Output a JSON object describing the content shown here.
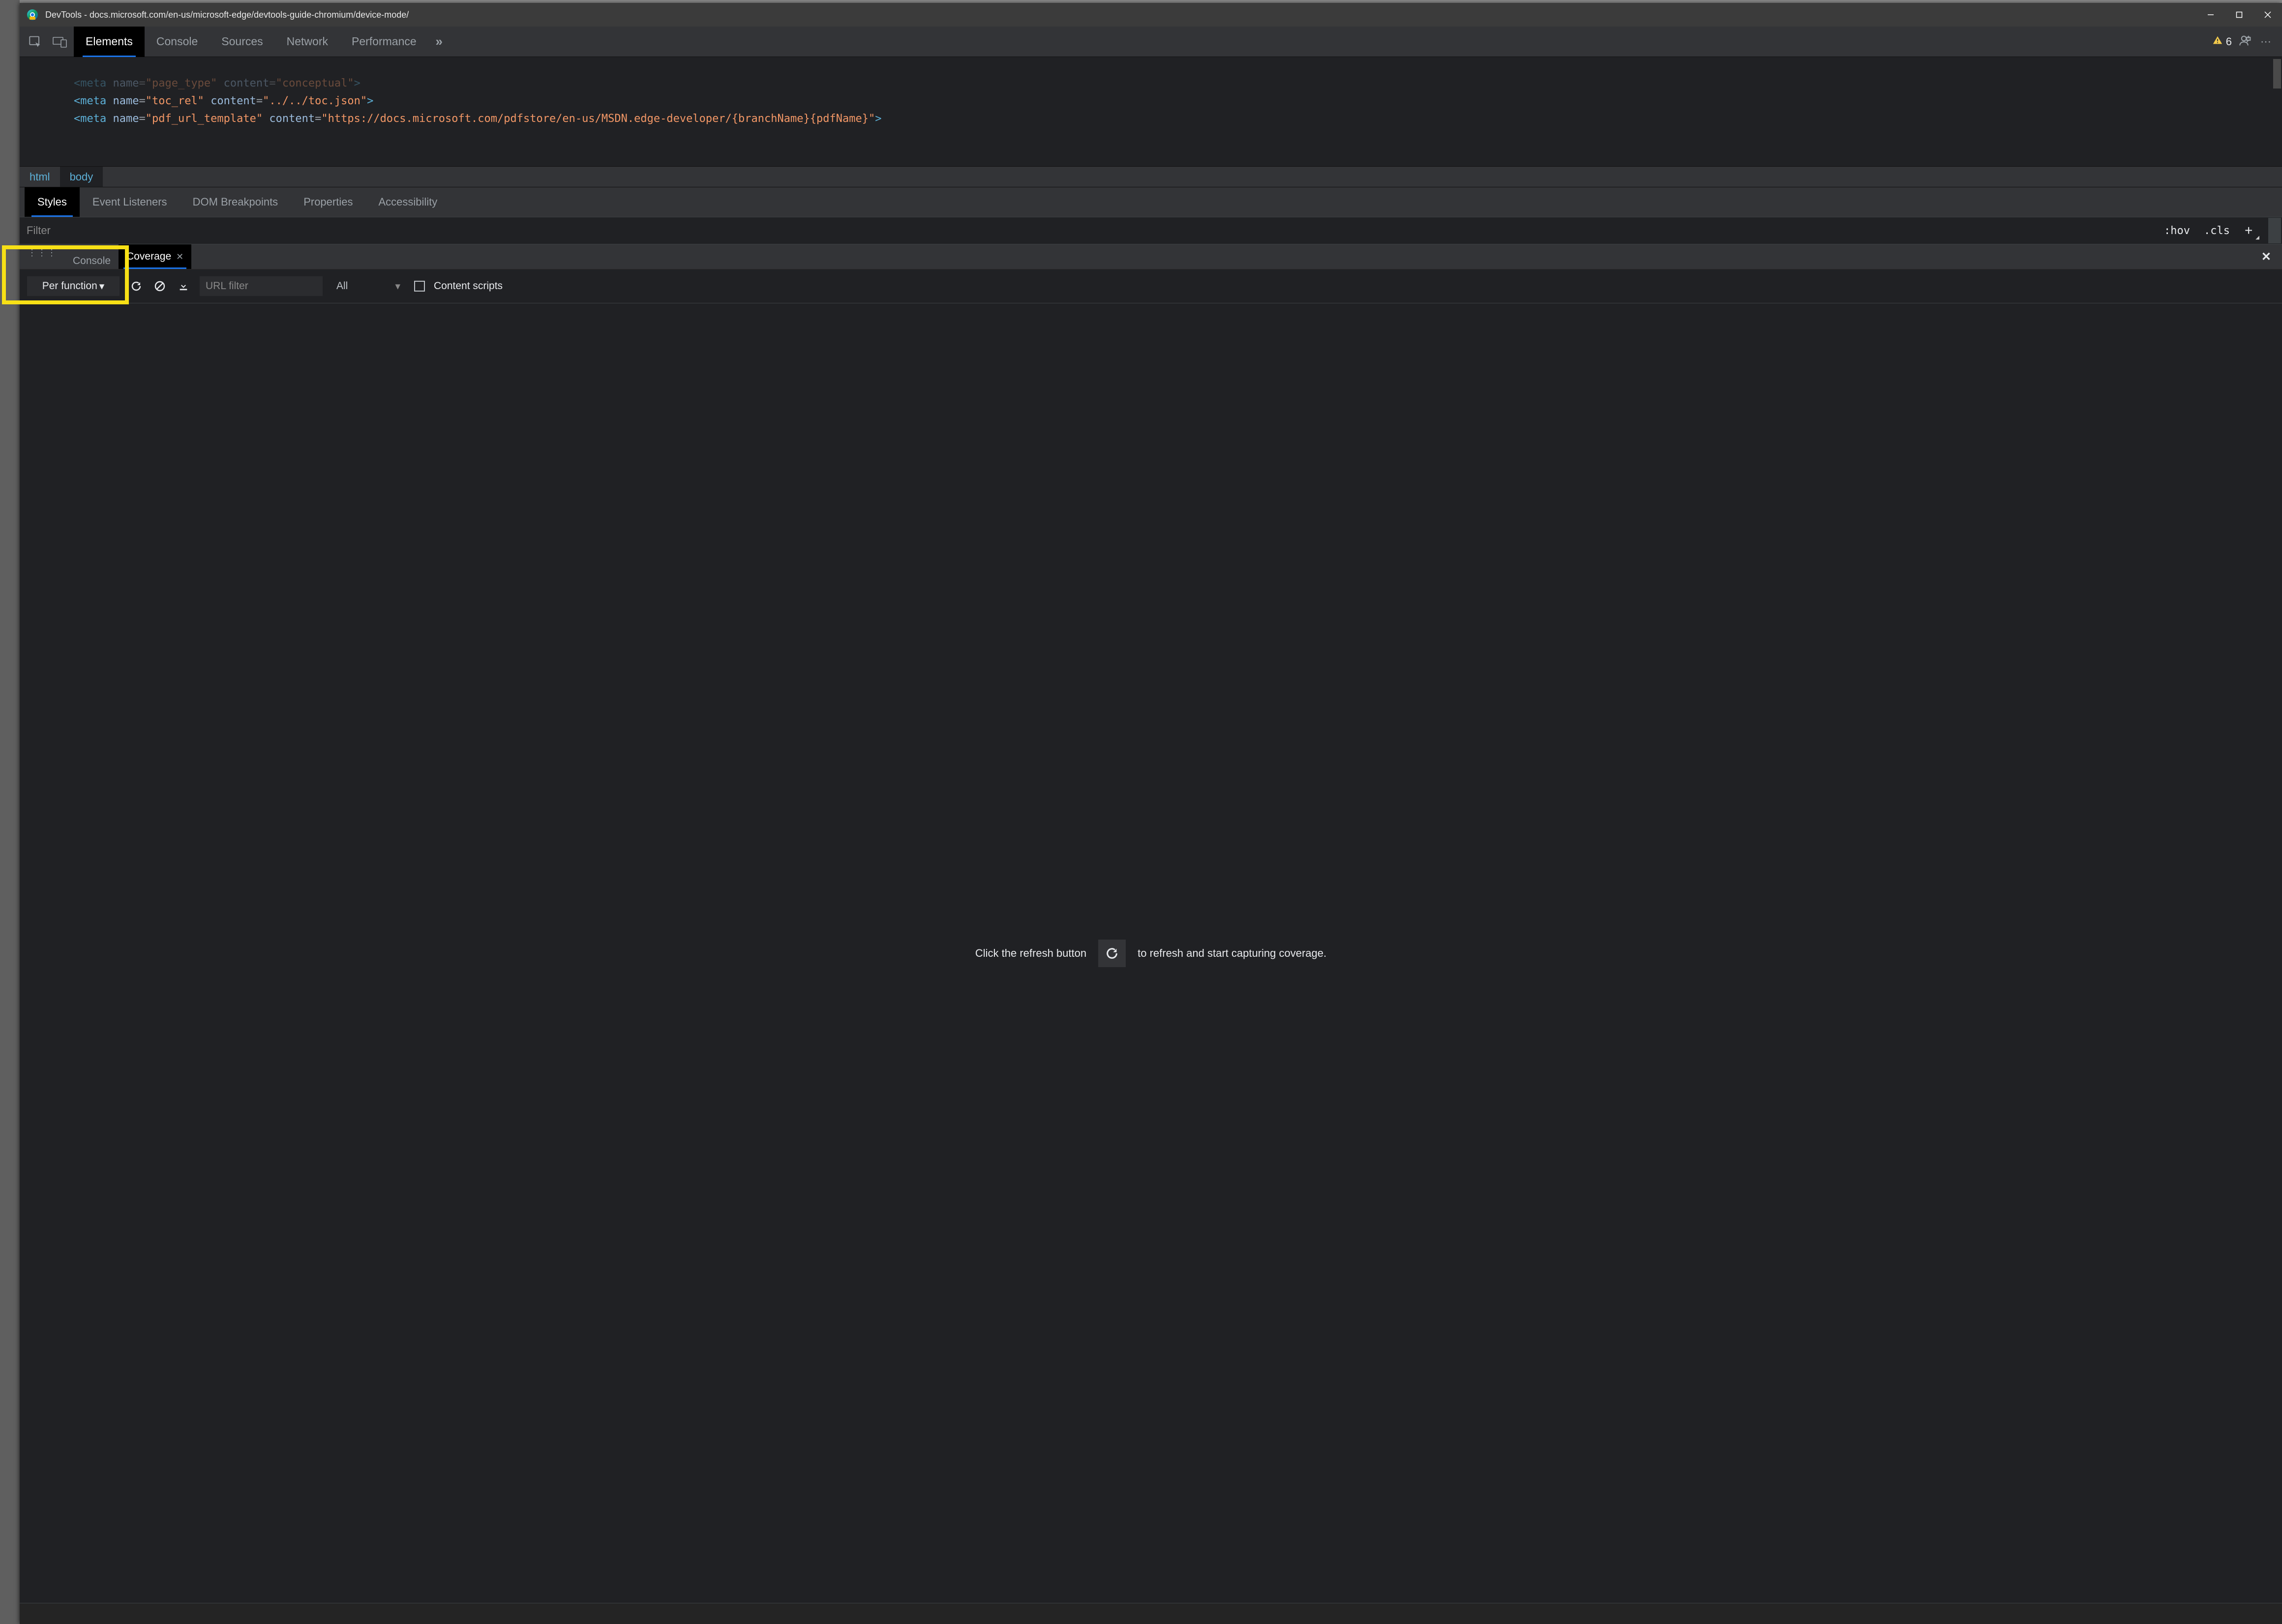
{
  "window": {
    "title": "DevTools - docs.microsoft.com/en-us/microsoft-edge/devtools-guide-chromium/device-mode/"
  },
  "toolbar": {
    "tabs": [
      "Elements",
      "Console",
      "Sources",
      "Network",
      "Performance"
    ],
    "active_tab": "Elements",
    "warning_count": "6"
  },
  "dom": {
    "line0_pre": "<meta ",
    "line0_attr1": "name",
    "line0_val1": "\"page_type\"",
    "line0_attr2": "content",
    "line0_val2": "\"conceptual\"",
    "line0_end": ">",
    "line1_pre": "<meta ",
    "line1_attr1": "name",
    "line1_val1": "\"toc_rel\"",
    "line1_attr2": "content",
    "line1_val2": "\"../../toc.json\"",
    "line1_end": ">",
    "line2_pre": "<meta ",
    "line2_attr1": "name",
    "line2_val1": "\"pdf_url_template\"",
    "line2_attr2": "content",
    "line2_val2": "\"https://docs.microsoft.com/pdfstore/en-us/MSDN.edge-developer/{branchName}{pdfName}\"",
    "line2_end": ">"
  },
  "breadcrumb": {
    "items": [
      "html",
      "body"
    ]
  },
  "subtabs": {
    "items": [
      "Styles",
      "Event Listeners",
      "DOM Breakpoints",
      "Properties",
      "Accessibility"
    ],
    "active": "Styles"
  },
  "styles_panel": {
    "filter_placeholder": "Filter",
    "hov": ":hov",
    "cls": ".cls"
  },
  "drawer": {
    "console_label": "Console",
    "coverage_label": "Coverage"
  },
  "coverage": {
    "mode": "Per function",
    "url_filter_placeholder": "URL filter",
    "type_filter": "All",
    "content_scripts_label": "Content scripts",
    "body_pre": "Click the refresh button",
    "body_post": "to refresh and start capturing coverage."
  }
}
